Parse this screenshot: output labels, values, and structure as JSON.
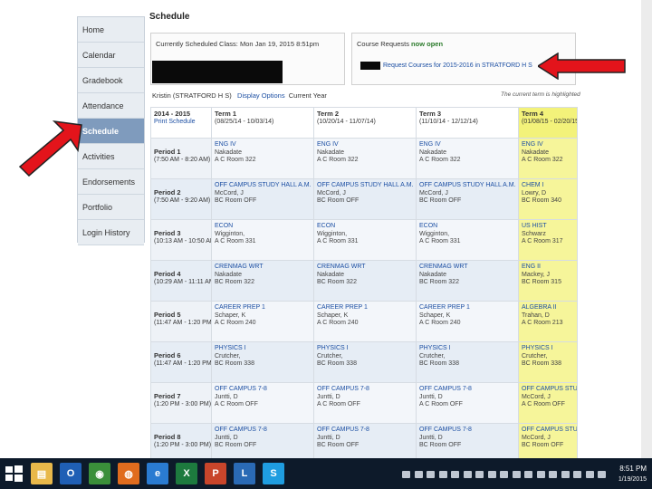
{
  "page": {
    "title": "Schedule"
  },
  "sidebar": {
    "items": [
      {
        "label": "Home",
        "active": false
      },
      {
        "label": "Calendar",
        "active": false
      },
      {
        "label": "Gradebook",
        "active": false
      },
      {
        "label": "Attendance",
        "active": false
      },
      {
        "label": "Schedule",
        "active": true
      },
      {
        "label": "Activities",
        "active": false
      },
      {
        "label": "Endorsements",
        "active": false
      },
      {
        "label": "Portfolio",
        "active": false
      },
      {
        "label": "Login History",
        "active": false
      }
    ]
  },
  "current_class": {
    "label": "Currently Scheduled Class: Mon Jan 19, 2015 8:51pm"
  },
  "course_requests": {
    "label_prefix": "Course Requests",
    "label_status": "now open",
    "link_text": "Request Courses for 2015-2016 in STRATFORD H S"
  },
  "subheader": {
    "student": "Kristin   (STRATFORD H S)",
    "display_options": "Display Options",
    "current_year": "Current Year",
    "note": "The current term is highlighted"
  },
  "schedule": {
    "year": "2014 - 2015",
    "print_link": "Print Schedule",
    "terms": [
      {
        "name": "Term 1",
        "dates": "(08/25/14 - 10/03/14)"
      },
      {
        "name": "Term 2",
        "dates": "(10/20/14 - 11/07/14)"
      },
      {
        "name": "Term 3",
        "dates": "(11/10/14 - 12/12/14)"
      },
      {
        "name": "Term 4",
        "dates": "(01/08/15 - 02/20/15)"
      }
    ],
    "periods": [
      {
        "name": "Period 1",
        "time": "(7:50 AM - 8:20 AM)",
        "cells": [
          [
            "ENG IV",
            "Nakadate",
            "A C   Room 322"
          ],
          [
            "ENG IV",
            "Nakadate",
            "A C   Room 322"
          ],
          [
            "ENG IV",
            "Nakadate",
            "A C   Room 322"
          ],
          [
            "ENG IV",
            "Nakadate",
            "A C   Room 322"
          ]
        ]
      },
      {
        "name": "Period 2",
        "time": "(7:50 AM - 9:20 AM)",
        "cells": [
          [
            "OFF CAMPUS STUDY HALL A.M.",
            "McCord, J",
            "BC   Room OFF"
          ],
          [
            "OFF CAMPUS STUDY HALL A.M.",
            "McCord, J",
            "BC   Room OFF"
          ],
          [
            "OFF CAMPUS STUDY HALL A.M.",
            "McCord, J",
            "BC   Room OFF"
          ],
          [
            "CHEM I",
            "Lowry, D",
            "BC   Room 340"
          ]
        ]
      },
      {
        "name": "Period 3",
        "time": "(10:13 AM - 10:50 AM)",
        "cells": [
          [
            "ECON",
            "Wigginton,",
            "A C   Room 331"
          ],
          [
            "ECON",
            "Wigginton,",
            "A C   Room 331"
          ],
          [
            "ECON",
            "Wigginton,",
            "A C   Room 331"
          ],
          [
            "US HIST",
            "Schwarz",
            "A C   Room 317"
          ]
        ]
      },
      {
        "name": "Period 4",
        "time": "(10:29 AM - 11:11 AM)",
        "cells": [
          [
            "CRENMAG WRT",
            "Nakadate",
            "BC   Room 322"
          ],
          [
            "CRENMAG WRT",
            "Nakadate",
            "BC   Room 322"
          ],
          [
            "CRENMAG WRT",
            "Nakadate",
            "BC   Room 322"
          ],
          [
            "ENG II",
            "Mackey, J",
            "BC   Room 315"
          ]
        ]
      },
      {
        "name": "Period 5",
        "time": "(11:47 AM - 1:20 PM)",
        "cells": [
          [
            "CAREER PREP 1",
            "Schaper, K",
            "A C   Room 240"
          ],
          [
            "CAREER PREP 1",
            "Schaper, K",
            "A C   Room 240"
          ],
          [
            "CAREER PREP 1",
            "Schaper, K",
            "A C   Room 240"
          ],
          [
            "ALGEBRA II",
            "Trahan, D",
            "A C   Room 213"
          ]
        ]
      },
      {
        "name": "Period 6",
        "time": "(11:47 AM - 1:20 PM)",
        "cells": [
          [
            "PHYSICS I",
            "Crutcher,",
            "BC   Room 338"
          ],
          [
            "PHYSICS I",
            "Crutcher,",
            "BC   Room 338"
          ],
          [
            "PHYSICS I",
            "Crutcher,",
            "BC   Room 338"
          ],
          [
            "PHYSICS I",
            "Crutcher,",
            "BC   Room 338"
          ]
        ]
      },
      {
        "name": "Period 7",
        "time": "(1:20 PM - 3:00 PM)",
        "cells": [
          [
            "OFF CAMPUS 7-8",
            "Juntti, D",
            "A C   Room OFF"
          ],
          [
            "OFF CAMPUS 7-8",
            "Juntti, D",
            "A C   Room OFF"
          ],
          [
            "OFF CAMPUS 7-8",
            "Juntti, D",
            "A C   Room OFF"
          ],
          [
            "OFF CAMPUS STU",
            "McCord, J",
            "A C   Room OFF"
          ]
        ]
      },
      {
        "name": "Period 8",
        "time": "(1:20 PM - 3:00 PM)",
        "cells": [
          [
            "OFF CAMPUS 7-8",
            "Juntti, D",
            "BC   Room OFF"
          ],
          [
            "OFF CAMPUS 7-8",
            "Juntti, D",
            "BC   Room OFF"
          ],
          [
            "OFF CAMPUS 7-8",
            "Juntti, D",
            "BC   Room OFF"
          ],
          [
            "OFF CAMPUS STU",
            "McCord, J",
            "BC   Room OFF"
          ]
        ]
      }
    ]
  },
  "taskbar": {
    "apps": [
      {
        "icon": "file-explorer-icon",
        "glyph": "▤",
        "color": "#e8b84a"
      },
      {
        "icon": "outlook-icon",
        "glyph": "O",
        "color": "#1f5fb5"
      },
      {
        "icon": "chrome-icon",
        "glyph": "◉",
        "color": "#3a8f3a"
      },
      {
        "icon": "firefox-icon",
        "glyph": "◍",
        "color": "#e06c1e"
      },
      {
        "icon": "internet-explorer-icon",
        "glyph": "e",
        "color": "#2a7bd1"
      },
      {
        "icon": "excel-icon",
        "glyph": "X",
        "color": "#1d7a3e"
      },
      {
        "icon": "powerpoint-icon",
        "glyph": "P",
        "color": "#c8452b"
      },
      {
        "icon": "lync-icon",
        "glyph": "L",
        "color": "#2a6ab5"
      },
      {
        "icon": "skype-icon",
        "glyph": "S",
        "color": "#1f9de0"
      }
    ],
    "time": "8:51 PM",
    "date": "1/19/2015"
  },
  "colors": {
    "accent": "#7f9bbd",
    "arrow": "#e3141b",
    "current_term": "#f6f59a",
    "link": "#1c4fa3"
  }
}
